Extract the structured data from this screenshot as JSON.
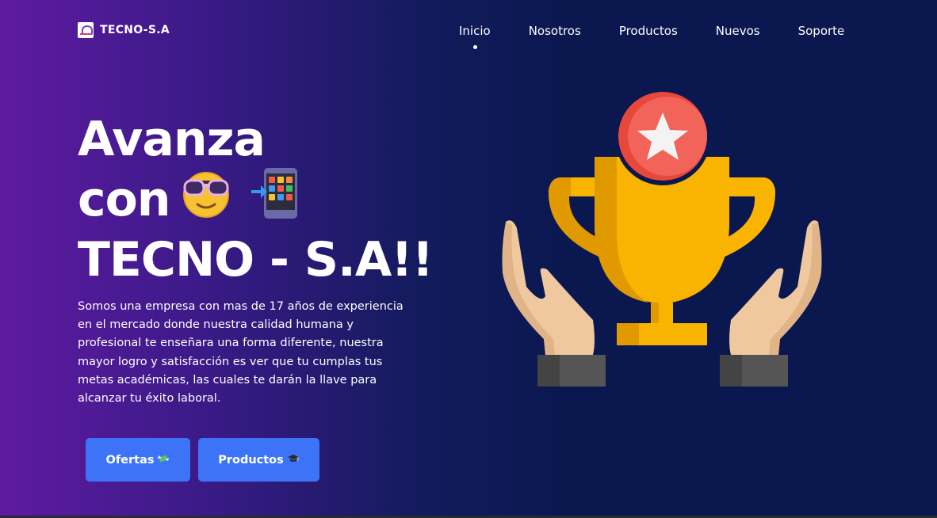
{
  "header": {
    "brand_name": "TECNO-S.A",
    "nav": [
      {
        "label": "Inicio",
        "active": true
      },
      {
        "label": "Nosotros",
        "active": false
      },
      {
        "label": "Productos",
        "active": false
      },
      {
        "label": "Nuevos",
        "active": false
      },
      {
        "label": "Soporte",
        "active": false
      }
    ]
  },
  "hero": {
    "title_line1": "Avanza",
    "title_line2": "con",
    "title_line3": "TECNO - S.A!!",
    "title_icons": [
      "sunglasses-emoji-icon",
      "mobile-apps-icon"
    ],
    "description": "Somos una empresa con mas de 17 años de experiencia en el mercado donde nuestra calidad humana y profesional te enseñara una forma diferente, nuestra mayor logro y satisfacción es ver que tu cumplas tus metas académicas, las cuales te darán la llave para alcanzar tu éxito laboral.",
    "buttons": {
      "ofertas_label": "Ofertas",
      "productos_label": "Productos"
    },
    "button_icons": [
      "money-with-wings-icon",
      "graduation-cap-icon"
    ]
  },
  "illustration": "trophy-in-hands-icon",
  "colors": {
    "accent_button": "#3d74f7",
    "background_dark": "#0b1850",
    "background_purple": "#5f1aa1",
    "trophy_gold": "#f8b400",
    "medal_red": "#f2594b"
  }
}
